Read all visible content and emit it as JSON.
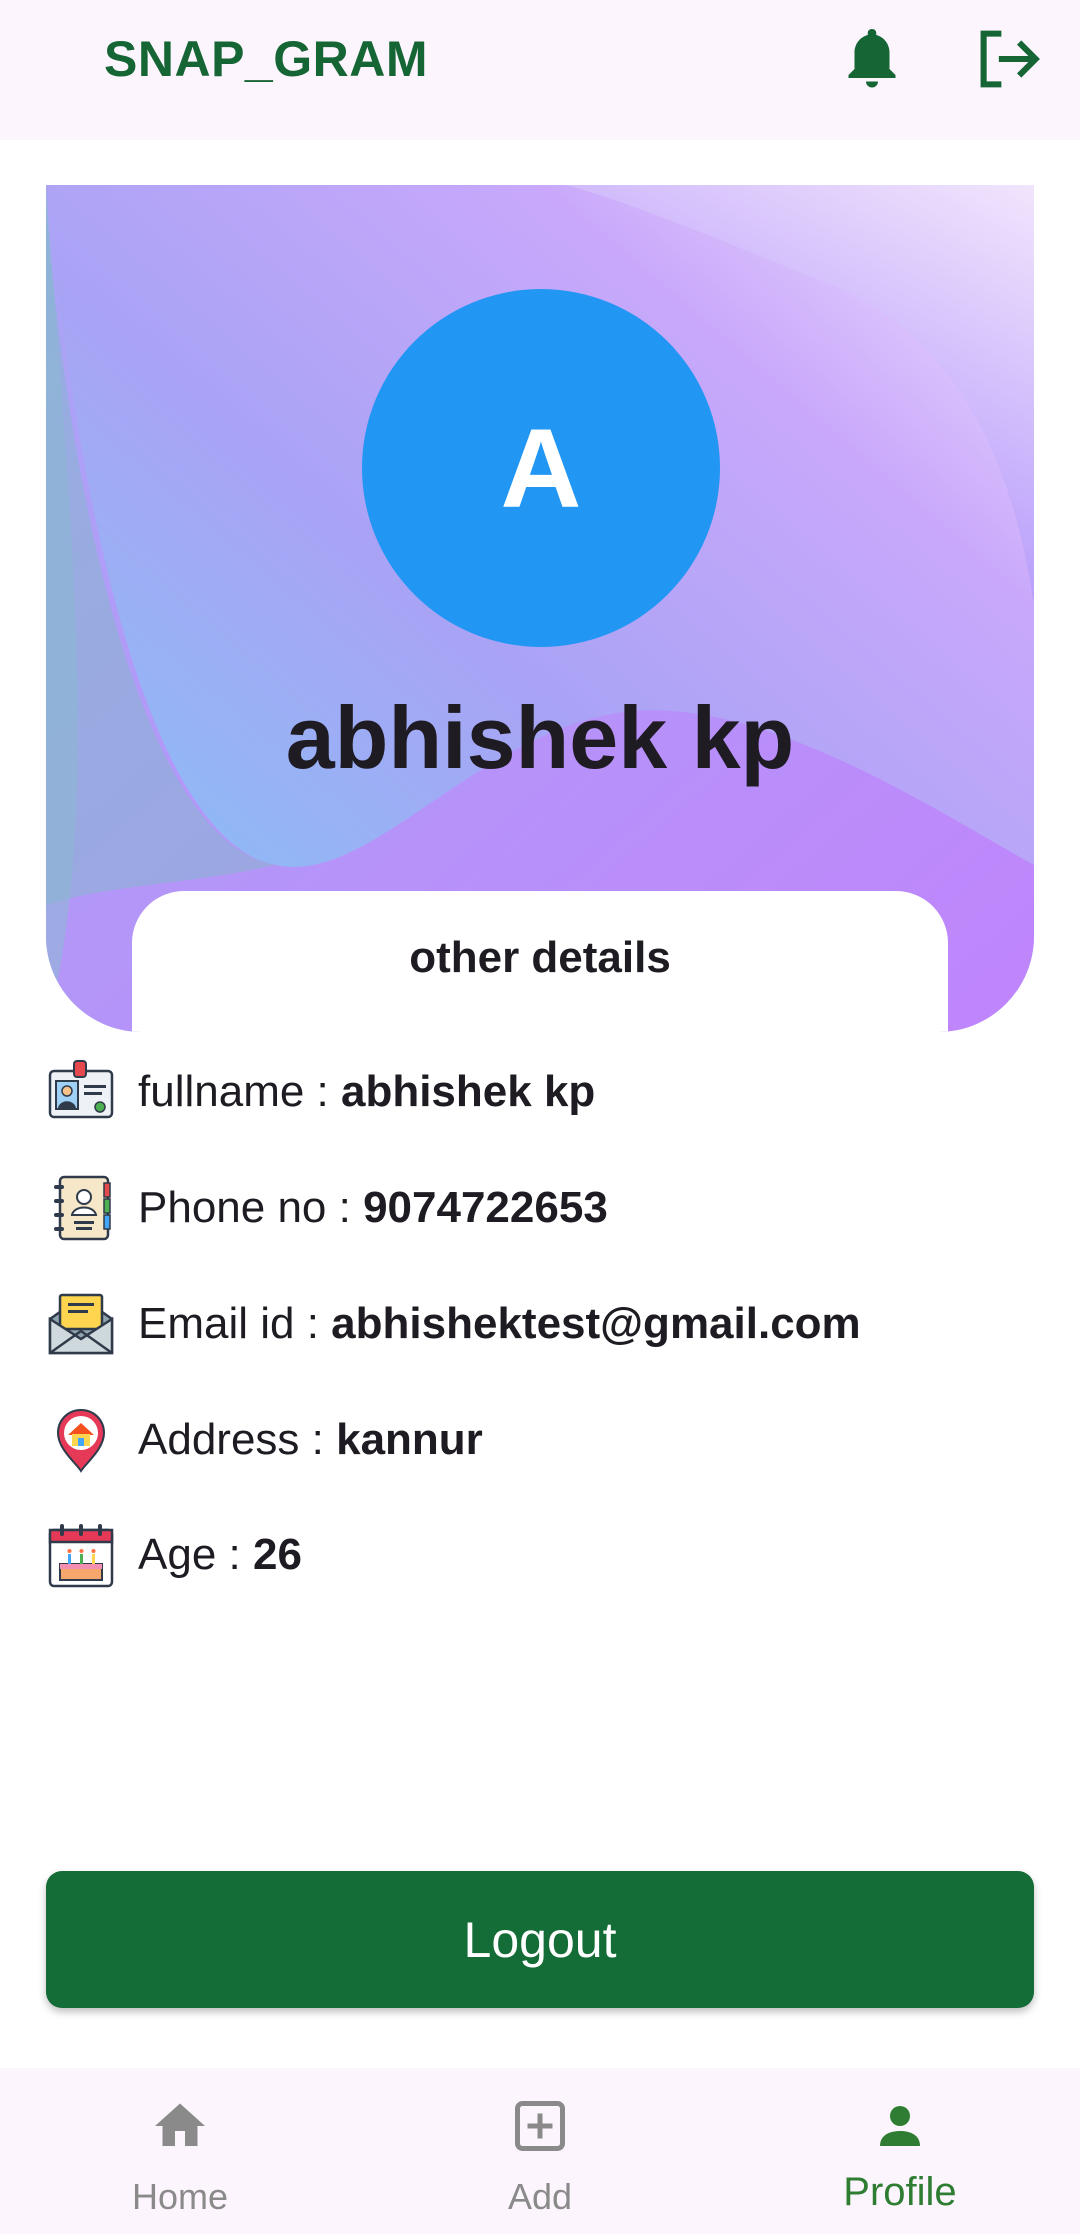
{
  "app": {
    "title": "SNAP_GRAM",
    "accent_color": "#166534",
    "icons": [
      "bell-icon",
      "logout-icon"
    ]
  },
  "profile": {
    "avatar_letter": "A",
    "avatar_color": "#2196f3",
    "name": "abhishek kp",
    "details_title": "other details"
  },
  "details": [
    {
      "icon": "id-card-icon",
      "label": "fullname : ",
      "value": "abhishek kp"
    },
    {
      "icon": "contact-book-icon",
      "label": "Phone no : ",
      "value": "9074722653"
    },
    {
      "icon": "email-icon",
      "label": "Email id : ",
      "value": "abhishektest@gmail.com"
    },
    {
      "icon": "home-location-icon",
      "label": "Address : ",
      "value": "kannur"
    },
    {
      "icon": "birthday-calendar-icon",
      "label": "Age : ",
      "value": "26"
    }
  ],
  "logout_button": {
    "label": "Logout",
    "color": "#146c37"
  },
  "nav": {
    "items": [
      {
        "label": "Home",
        "icon": "home-icon",
        "active": false
      },
      {
        "label": "Add",
        "icon": "add-box-icon",
        "active": false
      },
      {
        "label": "Profile",
        "icon": "person-icon",
        "active": true
      }
    ],
    "active_color": "#2e7d32",
    "inactive_color": "#8a8a8a"
  }
}
